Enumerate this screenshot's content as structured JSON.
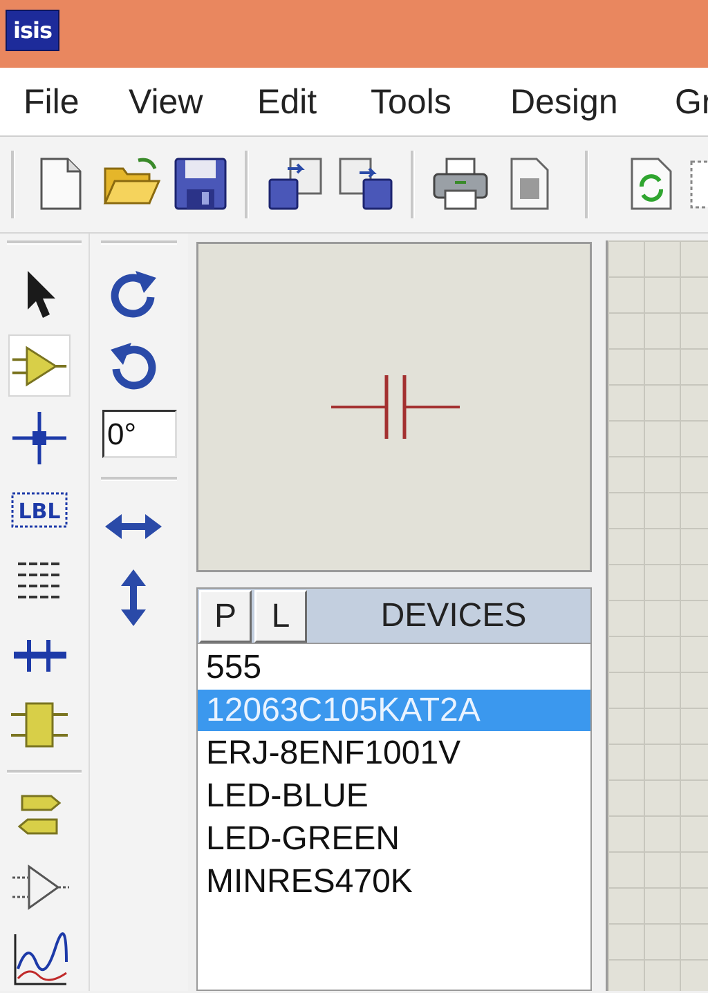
{
  "app": {
    "logo_text": "isis",
    "titlebar_color": "#e9875f"
  },
  "menu": [
    {
      "label": "File"
    },
    {
      "label": "View"
    },
    {
      "label": "Edit"
    },
    {
      "label": "Tools"
    },
    {
      "label": "Design"
    },
    {
      "label": "Gr"
    }
  ],
  "toolbar": {
    "icons": [
      "new-file-icon",
      "open-folder-icon",
      "save-icon",
      "import-icon",
      "export-icon",
      "print-icon",
      "page-icon",
      "refresh-icon"
    ]
  },
  "rotation": {
    "angle_value": "0°"
  },
  "devices": {
    "p_label": "P",
    "l_label": "L",
    "title": "DEVICES",
    "items": [
      "555",
      "12063C105KAT2A",
      "ERJ-8ENF1001V",
      "LED-BLUE",
      "LED-GREEN",
      "MINRES470K"
    ],
    "selected_index": 1,
    "selection_color": "#3b98ee"
  }
}
